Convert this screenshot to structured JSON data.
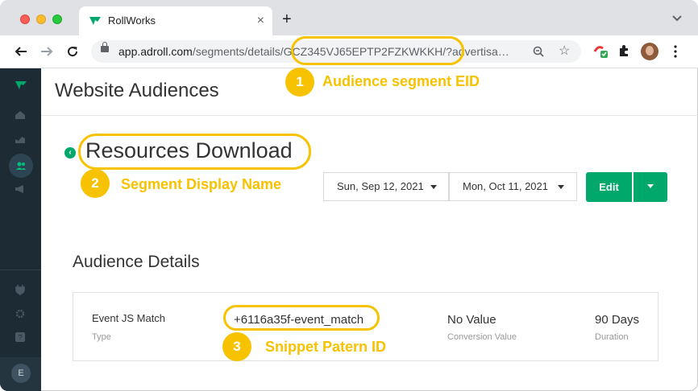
{
  "browser": {
    "tab_title": "RollWorks",
    "tab_close": "×",
    "new_tab": "+",
    "tab_menu": "⌄",
    "url_host": "app.adroll.com",
    "url_path": "/segments/details/",
    "url_eid": "GCZ345VJ65EPTP2FZKWKKH",
    "url_rest": "/?advertisa…"
  },
  "sidebar": {
    "avatar_initial": "E"
  },
  "page": {
    "header": "Website Audiences",
    "segment_title": "Resources Download",
    "date_start": "Sun, Sep 12, 2021",
    "date_end": "Mon, Oct 11, 2021",
    "edit_label": "Edit",
    "details_title": "Audience Details"
  },
  "audience_details": {
    "type_value": "Event JS Match",
    "type_label": "Type",
    "pattern_value": "+6116a35f-event_match",
    "conversion_value": "No Value",
    "conversion_label": "Conversion Value",
    "duration_value": "90 Days",
    "duration_label": "Duration"
  },
  "annotations": [
    {
      "number": "1",
      "text": "Audience segment EID"
    },
    {
      "number": "2",
      "text": "Segment Display Name"
    },
    {
      "number": "3",
      "text": "Snippet Patern ID"
    }
  ],
  "colors": {
    "accent_green": "#00a86b",
    "annotation_yellow": "#f7c200",
    "sidebar_bg": "#1d2b35"
  }
}
